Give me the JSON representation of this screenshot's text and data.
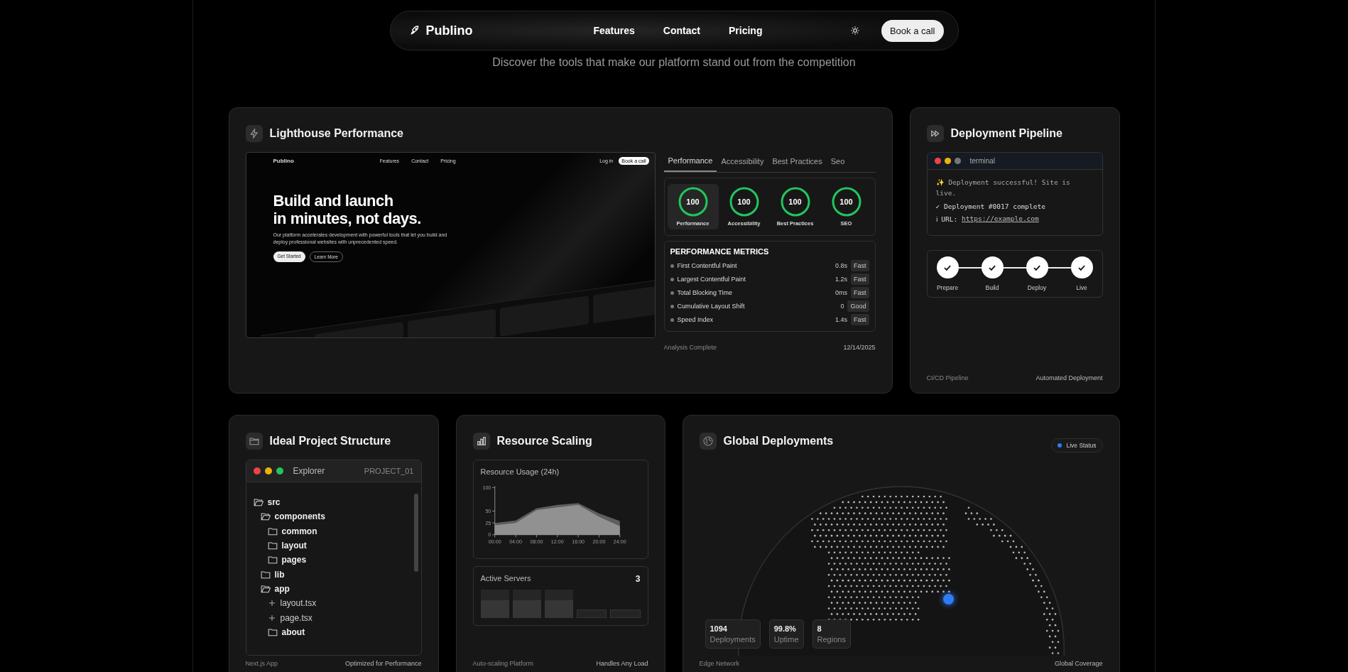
{
  "nav": {
    "brand": "Publino",
    "links": [
      {
        "label": "Features"
      },
      {
        "label": "Contact"
      },
      {
        "label": "Pricing"
      }
    ],
    "cta": "Book a call"
  },
  "subtitle": "Discover the tools that make our platform stand out from the competition",
  "lighthouse": {
    "title": "Lighthouse Performance",
    "preview": {
      "brand": "Publino",
      "links": [
        "Features",
        "Contact",
        "Pricing"
      ],
      "login": "Log in",
      "cta": "Book a call",
      "headline_1": "Build and launch",
      "headline_2": "in minutes, not days.",
      "body": "Our platform accelerates development with powerful tools that let you build and deploy professional websites with unprecedented speed.",
      "primary": "Get Started",
      "secondary": "Learn More"
    },
    "tabs": [
      {
        "label": "Performance",
        "selected": true
      },
      {
        "label": "Accessibility",
        "selected": false
      },
      {
        "label": "Best Practices",
        "selected": false
      },
      {
        "label": "Seo",
        "selected": false
      }
    ],
    "scores": [
      {
        "value": "100",
        "label": "Performance",
        "selected": true
      },
      {
        "value": "100",
        "label": "Accessibility",
        "selected": false
      },
      {
        "value": "100",
        "label": "Best Practices",
        "selected": false
      },
      {
        "value": "100",
        "label": "SEO",
        "selected": false
      }
    ],
    "metrics_title": "PERFORMANCE METRICS",
    "metrics": [
      {
        "name": "First Contentful Paint",
        "value": "0.8s",
        "rating": "Fast"
      },
      {
        "name": "Largest Contentful Paint",
        "value": "1.2s",
        "rating": "Fast"
      },
      {
        "name": "Total Blocking Time",
        "value": "0ms",
        "rating": "Fast"
      },
      {
        "name": "Cumulative Layout Shift",
        "value": "0",
        "rating": "Good"
      },
      {
        "name": "Speed Index",
        "value": "1.4s",
        "rating": "Fast"
      }
    ],
    "footer_left": "Analysis Complete",
    "footer_right": "12/14/2025"
  },
  "pipeline": {
    "title": "Deployment Pipeline",
    "terminal_title": "terminal",
    "lines": [
      {
        "kind": "text",
        "icon": "✨",
        "text": "Deployment successful! Site is live."
      },
      {
        "kind": "text",
        "icon": "✓",
        "text": "Deployment #0017 complete"
      },
      {
        "kind": "link",
        "icon": "ℹ",
        "text": "URL:",
        "link": "https://example.com"
      }
    ],
    "steps": [
      {
        "label": "Prepare",
        "done": true
      },
      {
        "label": "Build",
        "done": true
      },
      {
        "label": "Deploy",
        "done": true
      },
      {
        "label": "Live",
        "done": true
      }
    ],
    "footer_left": "CI/CD Pipeline",
    "footer_right": "Automated Deployment"
  },
  "structure": {
    "title": "Ideal Project Structure",
    "explorer": "Explorer",
    "project": "PROJECT_01",
    "tree": [
      {
        "name": "src",
        "kind": "folder",
        "expanded": true,
        "children": [
          {
            "name": "components",
            "kind": "folder",
            "expanded": true,
            "children": [
              {
                "name": "common",
                "kind": "folder",
                "expanded": false
              },
              {
                "name": "layout",
                "kind": "folder",
                "expanded": false
              },
              {
                "name": "pages",
                "kind": "folder",
                "expanded": false
              }
            ]
          },
          {
            "name": "lib",
            "kind": "folder",
            "expanded": false
          },
          {
            "name": "app",
            "kind": "folder",
            "expanded": true,
            "children": [
              {
                "name": "layout.tsx",
                "kind": "file"
              },
              {
                "name": "page.tsx",
                "kind": "file"
              },
              {
                "name": "about",
                "kind": "folder",
                "expanded": false
              }
            ]
          }
        ]
      }
    ],
    "footer_left": "Next.js App",
    "footer_right": "Optimized for Performance"
  },
  "scaling": {
    "title": "Resource Scaling",
    "chart_data": {
      "type": "area",
      "title": "Resource Usage (24h)",
      "categories": [
        "00:00",
        "04:00",
        "08:00",
        "12:00",
        "16:00",
        "20:00",
        "24:00"
      ],
      "series": [
        {
          "color": "#6b6b6b",
          "values": [
            25,
            30,
            56,
            63,
            67,
            45,
            29
          ]
        },
        {
          "color": "#9a9a9a",
          "values": [
            20,
            25,
            52,
            58,
            63,
            38,
            18
          ]
        }
      ],
      "ylim": [
        0,
        100
      ],
      "yticks": [
        0,
        25,
        50,
        100
      ]
    },
    "servers_label": "Active Servers",
    "servers_count": "3",
    "servers": [
      {
        "active": true
      },
      {
        "active": true
      },
      {
        "active": true
      },
      {
        "active": false
      },
      {
        "active": false
      }
    ],
    "footer_left": "Auto-scaling Platform",
    "footer_right": "Handles Any Load"
  },
  "global": {
    "title": "Global Deployments",
    "status": "Live Status",
    "stats": [
      {
        "value": "1094",
        "label": "Deployments"
      },
      {
        "value": "99.8%",
        "label": "Uptime"
      },
      {
        "value": "8",
        "label": "Regions"
      }
    ],
    "footer_left": "Edge Network",
    "footer_right": "Global Coverage"
  }
}
